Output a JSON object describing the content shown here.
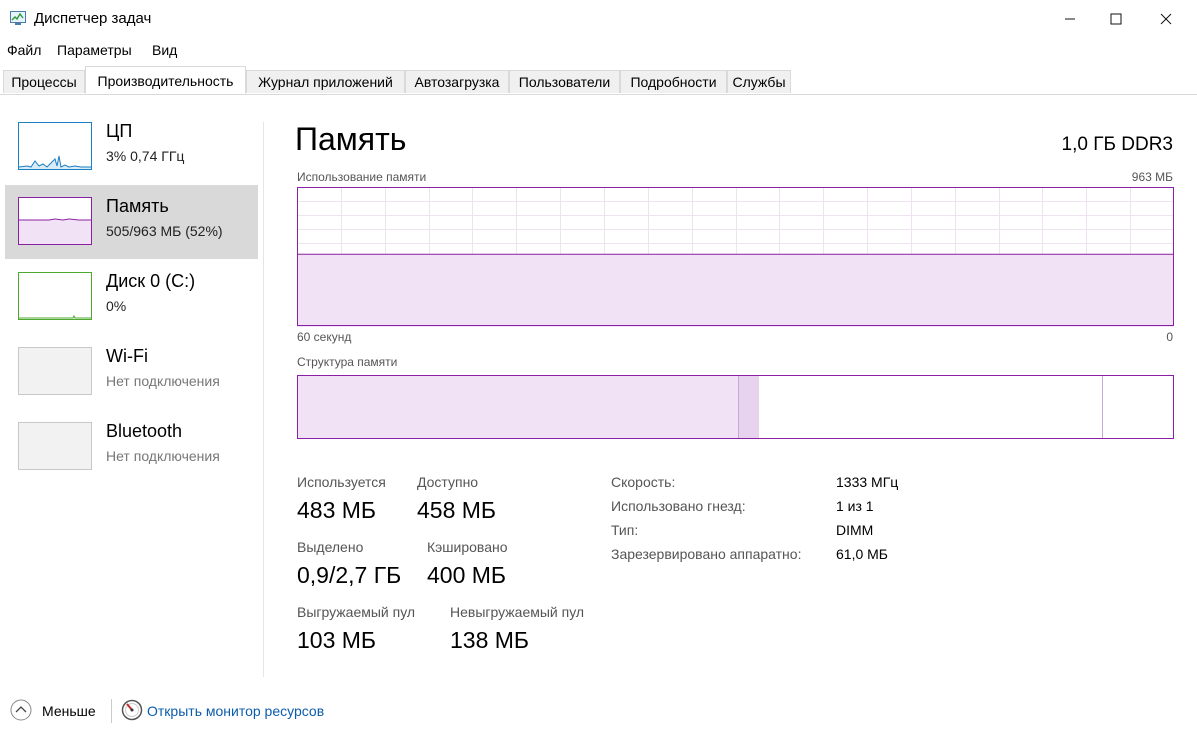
{
  "window": {
    "title": "Диспетчер задач",
    "controls": {
      "minimize": "—",
      "maximize": "☐",
      "close": "✕"
    }
  },
  "menu": [
    "Файл",
    "Параметры",
    "Вид"
  ],
  "tabs": [
    "Процессы",
    "Производительность",
    "Журнал приложений",
    "Автозагрузка",
    "Пользователи",
    "Подробности",
    "Службы"
  ],
  "active_tab": "Производительность",
  "sidebar": {
    "items": [
      {
        "title": "ЦП",
        "subtitle": "3%  0,74 ГГц",
        "color": "#1b7fc4"
      },
      {
        "title": "Память",
        "subtitle": "505/963 МБ (52%)",
        "color": "#8b1fa3",
        "selected": true
      },
      {
        "title": "Диск 0 (C:)",
        "subtitle": "0%",
        "color": "#4ea72e"
      },
      {
        "title": "Wi-Fi",
        "subtitle": "Нет подключения"
      },
      {
        "title": "Bluetooth",
        "subtitle": "Нет подключения"
      }
    ]
  },
  "main": {
    "title": "Память",
    "type": "1,0 ГБ DDR3",
    "usage_label": "Использование памяти",
    "usage_max": "963 МБ",
    "time_left": "60 секунд",
    "time_right": "0",
    "composition_label": "Структура памяти",
    "stats": {
      "in_use_label": "Используется",
      "in_use": "483 МБ",
      "available_label": "Доступно",
      "available": "458 МБ",
      "committed_label": "Выделено",
      "committed": "0,9/2,7 ГБ",
      "cached_label": "Кэшировано",
      "cached": "400 МБ",
      "paged_label": "Выгружаемый пул",
      "paged": "103 МБ",
      "nonpaged_label": "Невыгружаемый пул",
      "nonpaged": "138 МБ"
    },
    "info": {
      "speed_label": "Скорость:",
      "speed": "1333 МГц",
      "slots_label": "Использовано гнезд:",
      "slots": "1 из 1",
      "form_label": "Тип:",
      "form": "DIMM",
      "reserved_label": "Зарезервировано аппаратно:",
      "reserved": "61,0 МБ"
    },
    "accent": "#8b1fa3"
  },
  "footer": {
    "fewer": "Меньше",
    "monitor": "Открыть монитор ресурсов"
  },
  "chart_data": {
    "type": "area",
    "series": [
      {
        "values": [
          52,
          52,
          52,
          52,
          52,
          52,
          52,
          52,
          52,
          52,
          52,
          52,
          52,
          52,
          52,
          52,
          52,
          52,
          52,
          52,
          52,
          52,
          52,
          52,
          52,
          52,
          52,
          52,
          52,
          52,
          52,
          52,
          52,
          52,
          52,
          52,
          52,
          52,
          52,
          52,
          52,
          52,
          52,
          52,
          52,
          52,
          52,
          52,
          52,
          52,
          52,
          52,
          52,
          52,
          52,
          52,
          52,
          52,
          52,
          52
        ]
      }
    ],
    "xlabel": "60 секунд",
    "ylim": [
      0,
      100
    ]
  }
}
